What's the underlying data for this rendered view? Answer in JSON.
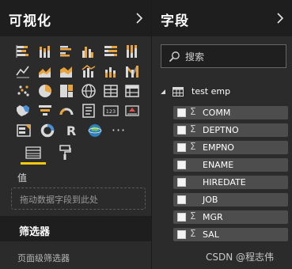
{
  "visualizations": {
    "title": "可视化",
    "icons": [
      [
        "stacked-bar-icon",
        "stacked-column-icon",
        "clustered-bar-icon",
        "clustered-column-icon",
        "100-stacked-bar-icon",
        "100-stacked-column-icon"
      ],
      [
        "line-chart-icon",
        "area-chart-icon",
        "stacked-area-icon",
        "line-clustered-column-icon",
        "line-stacked-column-icon",
        "ribbon-chart-icon"
      ],
      [
        "scatter-chart-icon",
        "pie-chart-icon",
        "treemap-icon",
        "globe-map-icon",
        "table-icon",
        "matrix-icon"
      ],
      [
        "filled-map-icon",
        "funnel-icon",
        "gauge-icon",
        "multi-row-card-icon",
        "card-icon",
        "kpi-icon"
      ],
      [
        "slicer-icon",
        "donut-icon",
        "r-script-icon",
        "arcgis-globe-icon",
        "more-visuals-icon"
      ]
    ],
    "card_label": "123",
    "r_label": "R",
    "more_label": "···"
  },
  "build": {
    "values_label": "值",
    "drop_zone_text": "拖动数据字段到此处"
  },
  "filters": {
    "title": "筛选器",
    "page_filters_label": "页面级筛选器"
  },
  "fields": {
    "title": "字段",
    "search_placeholder": "搜索",
    "table_name": "test emp",
    "items": [
      {
        "name": "COMM",
        "sigma": true
      },
      {
        "name": "DEPTNO",
        "sigma": true
      },
      {
        "name": "EMPNO",
        "sigma": true
      },
      {
        "name": "ENAME",
        "sigma": false
      },
      {
        "name": "HIREDATE",
        "sigma": false
      },
      {
        "name": "JOB",
        "sigma": false
      },
      {
        "name": "MGR",
        "sigma": true
      },
      {
        "name": "SAL",
        "sigma": true
      }
    ]
  },
  "sigma_symbol": "Σ",
  "watermark": "CSDN @程志伟",
  "colors": {
    "accent": "#f2c811",
    "pane_bg": "#2b2b2b",
    "header_bg": "#1e1e1e",
    "field_row_bg": "#4d4d4d"
  }
}
